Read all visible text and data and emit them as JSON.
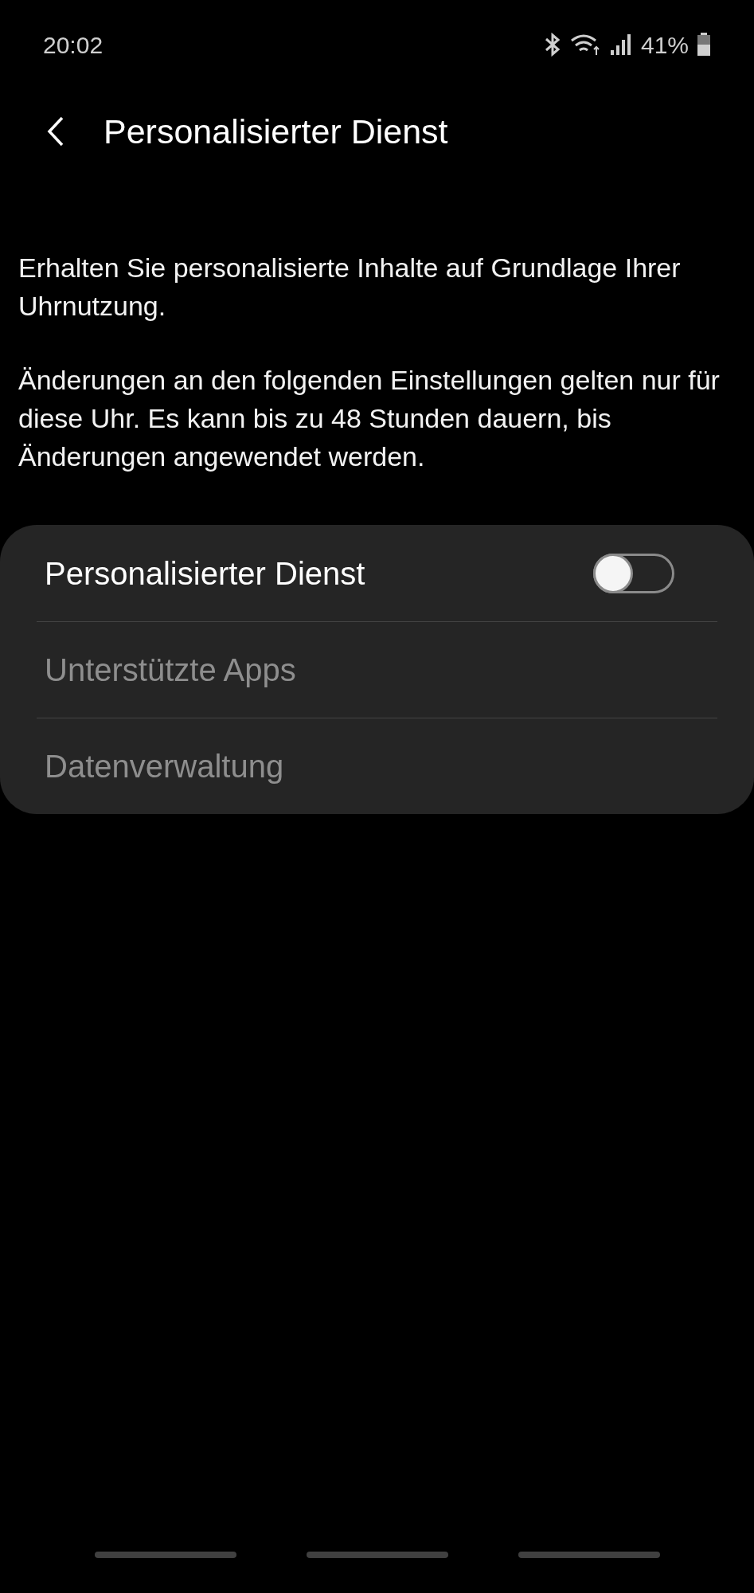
{
  "status_bar": {
    "time": "20:02",
    "battery": "41%"
  },
  "header": {
    "title": "Personalisierter Dienst"
  },
  "paragraphs": [
    "Erhalten Sie personalisierte Inhalte auf Grundlage Ihrer Uhrnutzung.",
    "Änderungen an den folgenden Einstellungen gelten nur für diese Uhr. Es kann bis zu 48 Stunden dauern, bis Änderungen angewendet werden."
  ],
  "settings": [
    {
      "kind": "switch",
      "label": "Personalisierter Dienst",
      "on": false,
      "disabled": false
    },
    {
      "kind": "link",
      "label": "Unterstützte Apps",
      "disabled": true
    },
    {
      "kind": "link",
      "label": "Datenverwaltung",
      "disabled": true
    }
  ]
}
